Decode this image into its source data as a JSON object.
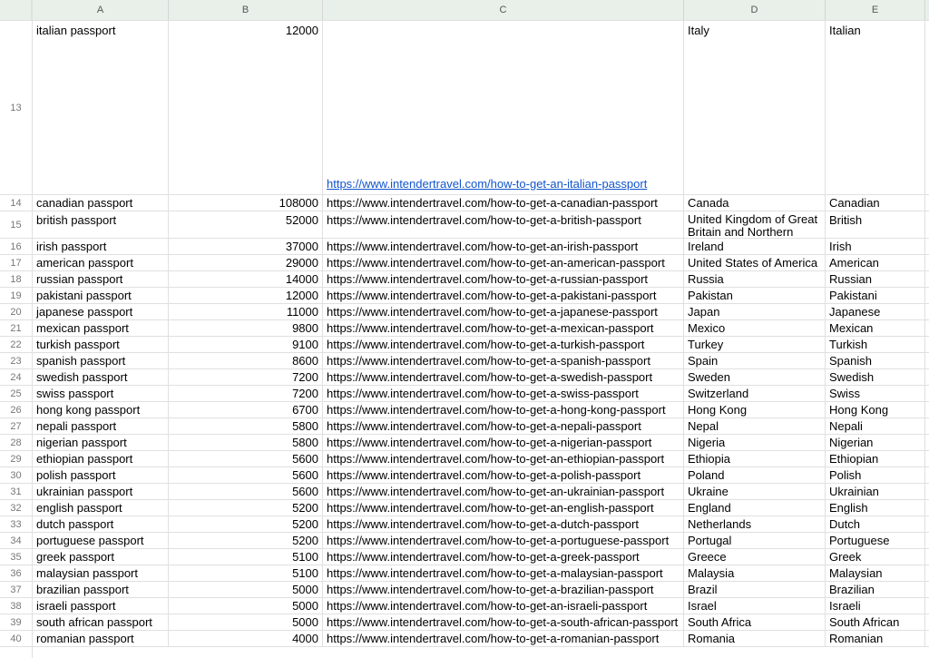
{
  "columns": [
    "A",
    "B",
    "C",
    "D",
    "E"
  ],
  "startRow": 13,
  "rows": [
    {
      "n": 13,
      "tall": true,
      "a": "italian passport",
      "b": "12000",
      "c": "https://www.intendertravel.com/how-to-get-an-italian-passport",
      "clink": true,
      "d": "Italy",
      "e": "Italian"
    },
    {
      "n": 14,
      "a": "canadian passport",
      "b": "108000",
      "c": "https://www.intendertravel.com/how-to-get-a-canadian-passport",
      "d": "Canada",
      "e": "Canadian"
    },
    {
      "n": 15,
      "dbl": true,
      "a": "british passport",
      "b": "52000",
      "c": "https://www.intendertravel.com/how-to-get-a-british-passport",
      "d": "United Kingdom of Great Britain and Northern Ireland",
      "e": "British"
    },
    {
      "n": 16,
      "a": "irish passport",
      "b": "37000",
      "c": "https://www.intendertravel.com/how-to-get-an-irish-passport",
      "d": "Ireland",
      "e": "Irish"
    },
    {
      "n": 17,
      "a": "american passport",
      "b": "29000",
      "c": "https://www.intendertravel.com/how-to-get-an-american-passport",
      "d": "United States of America",
      "e": "American"
    },
    {
      "n": 18,
      "a": "russian passport",
      "b": "14000",
      "c": "https://www.intendertravel.com/how-to-get-a-russian-passport",
      "d": "Russia",
      "e": "Russian"
    },
    {
      "n": 19,
      "a": "pakistani passport",
      "b": "12000",
      "c": "https://www.intendertravel.com/how-to-get-a-pakistani-passport",
      "d": "Pakistan",
      "e": "Pakistani"
    },
    {
      "n": 20,
      "a": "japanese passport",
      "b": "11000",
      "c": "https://www.intendertravel.com/how-to-get-a-japanese-passport",
      "d": "Japan",
      "e": "Japanese"
    },
    {
      "n": 21,
      "a": "mexican passport",
      "b": "9800",
      "c": "https://www.intendertravel.com/how-to-get-a-mexican-passport",
      "d": "Mexico",
      "e": "Mexican"
    },
    {
      "n": 22,
      "a": "turkish passport",
      "b": "9100",
      "c": "https://www.intendertravel.com/how-to-get-a-turkish-passport",
      "d": "Turkey",
      "e": "Turkish"
    },
    {
      "n": 23,
      "a": "spanish passport",
      "b": "8600",
      "c": "https://www.intendertravel.com/how-to-get-a-spanish-passport",
      "d": "Spain",
      "e": "Spanish"
    },
    {
      "n": 24,
      "a": "swedish passport",
      "b": "7200",
      "c": "https://www.intendertravel.com/how-to-get-a-swedish-passport",
      "d": "Sweden",
      "e": "Swedish"
    },
    {
      "n": 25,
      "a": "swiss passport",
      "b": "7200",
      "c": "https://www.intendertravel.com/how-to-get-a-swiss-passport",
      "d": "Switzerland",
      "e": "Swiss"
    },
    {
      "n": 26,
      "a": "hong kong passport",
      "b": "6700",
      "c": "https://www.intendertravel.com/how-to-get-a-hong-kong-passport",
      "d": "Hong Kong",
      "e": "Hong Kong"
    },
    {
      "n": 27,
      "a": "nepali passport",
      "b": "5800",
      "c": "https://www.intendertravel.com/how-to-get-a-nepali-passport",
      "d": "Nepal",
      "e": "Nepali"
    },
    {
      "n": 28,
      "a": "nigerian passport",
      "b": "5800",
      "c": "https://www.intendertravel.com/how-to-get-a-nigerian-passport",
      "d": "Nigeria",
      "e": "Nigerian"
    },
    {
      "n": 29,
      "a": "ethiopian passport",
      "b": "5600",
      "c": "https://www.intendertravel.com/how-to-get-an-ethiopian-passport",
      "d": "Ethiopia",
      "e": "Ethiopian"
    },
    {
      "n": 30,
      "a": "polish passport",
      "b": "5600",
      "c": "https://www.intendertravel.com/how-to-get-a-polish-passport",
      "d": "Poland",
      "e": "Polish"
    },
    {
      "n": 31,
      "a": "ukrainian passport",
      "b": "5600",
      "c": "https://www.intendertravel.com/how-to-get-an-ukrainian-passport",
      "d": "Ukraine",
      "e": "Ukrainian"
    },
    {
      "n": 32,
      "a": "english passport",
      "b": "5200",
      "c": "https://www.intendertravel.com/how-to-get-an-english-passport",
      "d": "England",
      "e": "English"
    },
    {
      "n": 33,
      "a": "dutch passport",
      "b": "5200",
      "c": "https://www.intendertravel.com/how-to-get-a-dutch-passport",
      "d": "Netherlands",
      "e": "Dutch"
    },
    {
      "n": 34,
      "a": "portuguese passport",
      "b": "5200",
      "c": "https://www.intendertravel.com/how-to-get-a-portuguese-passport",
      "d": "Portugal",
      "e": "Portuguese"
    },
    {
      "n": 35,
      "a": "greek passport",
      "b": "5100",
      "c": "https://www.intendertravel.com/how-to-get-a-greek-passport",
      "d": "Greece",
      "e": "Greek"
    },
    {
      "n": 36,
      "a": "malaysian passport",
      "b": "5100",
      "c": "https://www.intendertravel.com/how-to-get-a-malaysian-passport",
      "d": "Malaysia",
      "e": "Malaysian"
    },
    {
      "n": 37,
      "a": "brazilian passport",
      "b": "5000",
      "c": "https://www.intendertravel.com/how-to-get-a-brazilian-passport",
      "d": "Brazil",
      "e": "Brazilian"
    },
    {
      "n": 38,
      "a": "israeli passport",
      "b": "5000",
      "c": "https://www.intendertravel.com/how-to-get-an-israeli-passport",
      "d": "Israel",
      "e": "Israeli"
    },
    {
      "n": 39,
      "a": "south african passport",
      "b": "5000",
      "c": "https://www.intendertravel.com/how-to-get-a-south-african-passport",
      "d": "South Africa",
      "e": "South African"
    },
    {
      "n": 40,
      "a": "romanian passport",
      "b": "4000",
      "c": "https://www.intendertravel.com/how-to-get-a-romanian-passport",
      "d": "Romania",
      "e": "Romanian"
    }
  ]
}
